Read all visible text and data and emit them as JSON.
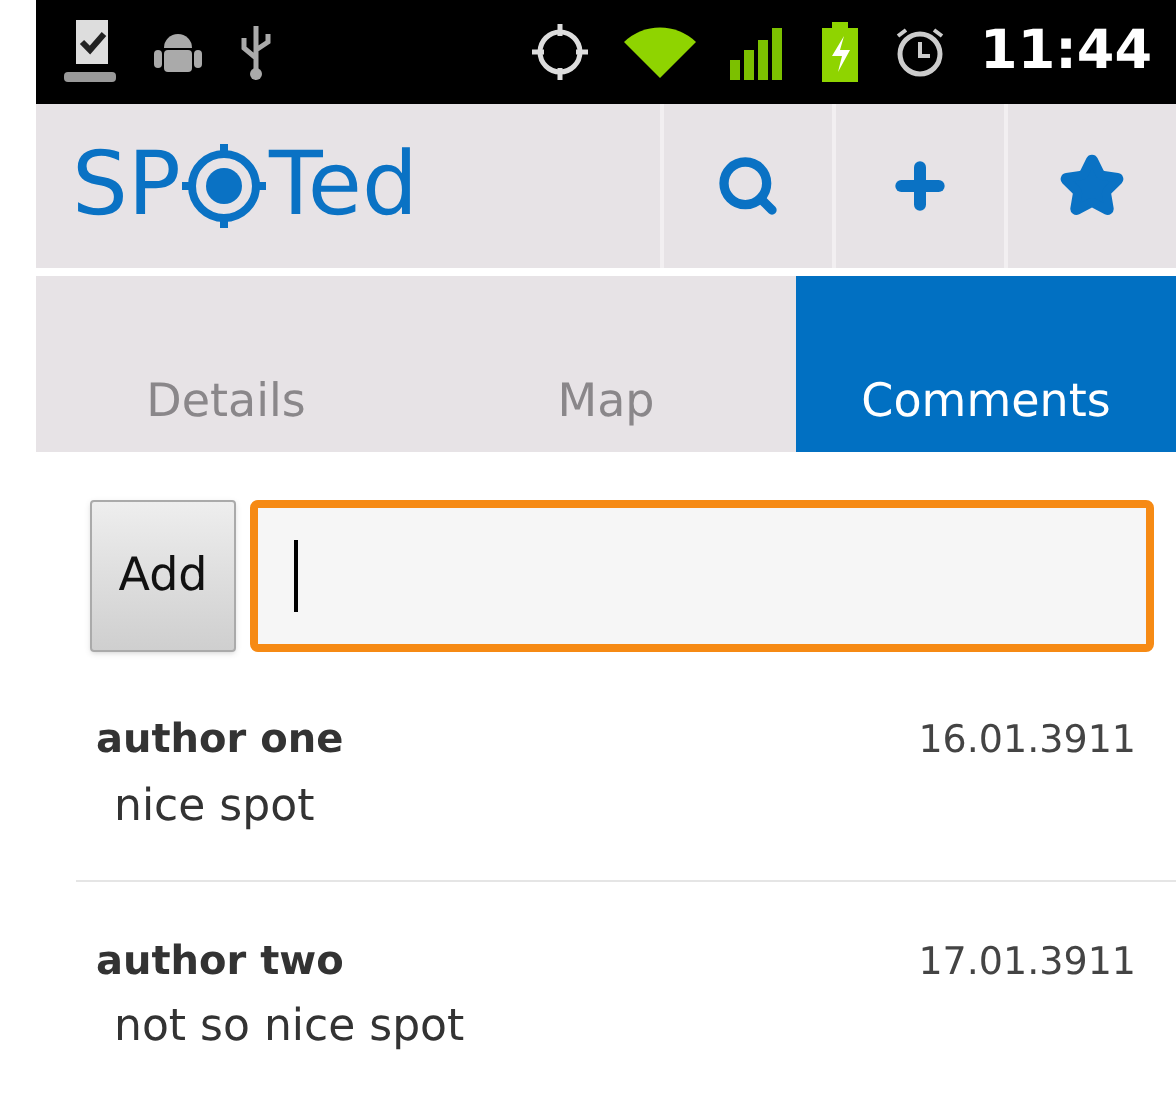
{
  "status_bar": {
    "time": "11:44"
  },
  "app_bar": {
    "logo_left": "SP",
    "logo_right": "Ted"
  },
  "tabs": [
    {
      "label": "Details",
      "selected": false
    },
    {
      "label": "Map",
      "selected": false
    },
    {
      "label": "Comments",
      "selected": true
    }
  ],
  "add_button": {
    "label": "Add"
  },
  "comment_field": {
    "focused": true
  },
  "comments": [
    {
      "author": "author one",
      "date": "16.01.3911",
      "text": "nice spot"
    },
    {
      "author": "author two",
      "date": "17.01.3911",
      "text": "not so nice spot"
    }
  ]
}
